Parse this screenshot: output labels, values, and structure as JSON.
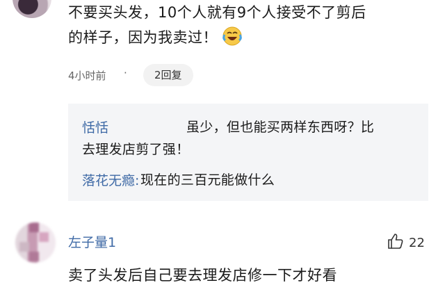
{
  "comment1": {
    "text_line1": "不要买头发，10个人就有9个人接受不了剪后",
    "text_line2": "的样子，因为我卖过！",
    "emoji": "laughing-crying-emoji",
    "time": "4小时前",
    "dot": "·",
    "reply_count": "2回复"
  },
  "replies": [
    {
      "user": "恬恬",
      "text_line1": "虽少，但也能买两样东西呀？比",
      "text_line2": "去理发店剪了强！"
    },
    {
      "user": "落花无瘾:",
      "text": "现在的三百元能做什么"
    }
  ],
  "comment2": {
    "user": "左子量1",
    "likes": "22",
    "text": "卖了头发后自己要去理发店修一下才好看"
  },
  "colors": {
    "username": "#3f6aa6",
    "reply_bg": "#f4f5f7",
    "pill_bg": "#f2f2f2"
  }
}
